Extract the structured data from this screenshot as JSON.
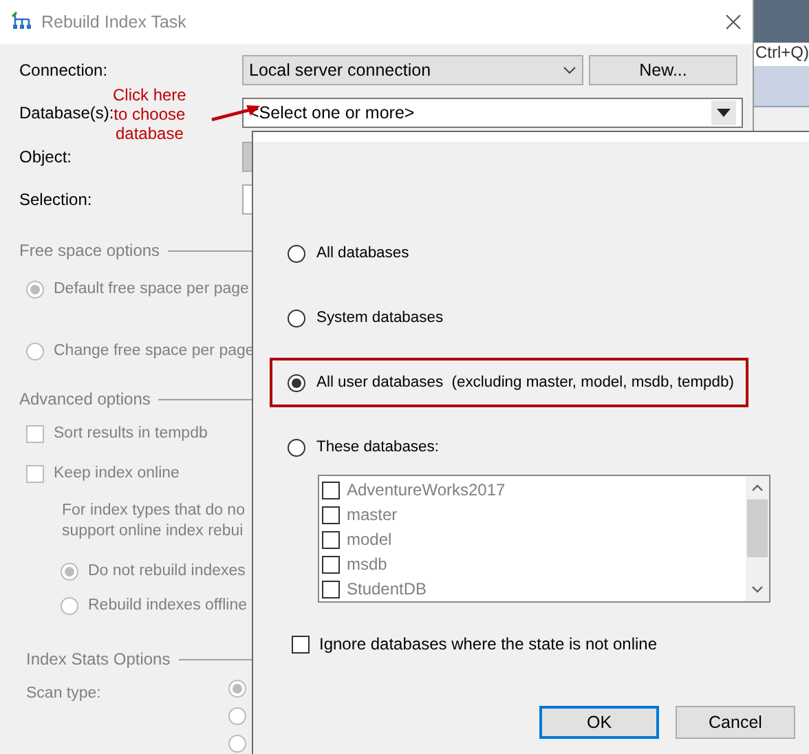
{
  "window": {
    "title": "Rebuild Index Task"
  },
  "background": {
    "search_hint": "Ctrl+Q)"
  },
  "form": {
    "connection": {
      "label": "Connection:",
      "value": "Local server connection",
      "new_button": "New..."
    },
    "databases": {
      "label": "Database(s):",
      "placeholder": "<Select one or more>"
    },
    "object": {
      "label": "Object:"
    },
    "selection": {
      "label": "Selection:"
    }
  },
  "annotation": {
    "text": "Click here\nto choose\ndatabase"
  },
  "free_space": {
    "title": "Free space options",
    "options": [
      {
        "label": "Default free space per page",
        "selected": true
      },
      {
        "label": "Change free space per page",
        "selected": false
      }
    ]
  },
  "advanced": {
    "title": "Advanced options",
    "checks": [
      {
        "label": "Sort results in tempdb",
        "checked": false
      },
      {
        "label": "Keep index online",
        "checked": false
      }
    ],
    "note_lines": [
      "For index types that do no",
      "support online index rebui"
    ],
    "online_options": [
      {
        "label": "Do not rebuild indexes",
        "selected": true
      },
      {
        "label": "Rebuild indexes offline",
        "selected": false
      }
    ]
  },
  "index_stats": {
    "title": "Index Stats Options",
    "scan_type_label": "Scan type:",
    "scan_options": [
      {
        "selected": true
      },
      {
        "selected": false
      },
      {
        "selected": false
      }
    ]
  },
  "popup": {
    "options": [
      {
        "label": "All databases",
        "selected": false,
        "highlighted": false
      },
      {
        "label": "System databases",
        "selected": false,
        "highlighted": false
      },
      {
        "label": "All user databases  (excluding master, model, msdb, tempdb)",
        "selected": true,
        "highlighted": true
      },
      {
        "label": "These databases:",
        "selected": false,
        "highlighted": false
      }
    ],
    "database_list": {
      "disabled": true,
      "items": [
        {
          "name": "AdventureWorks2017",
          "checked": false
        },
        {
          "name": "master",
          "checked": false
        },
        {
          "name": "model",
          "checked": false
        },
        {
          "name": "msdb",
          "checked": false
        },
        {
          "name": "StudentDB",
          "checked": false
        }
      ]
    },
    "ignore_offline": {
      "label": "Ignore databases where the state is not online",
      "checked": false
    },
    "buttons": [
      {
        "label": "OK",
        "default": true
      },
      {
        "label": "Cancel",
        "default": false
      }
    ]
  }
}
